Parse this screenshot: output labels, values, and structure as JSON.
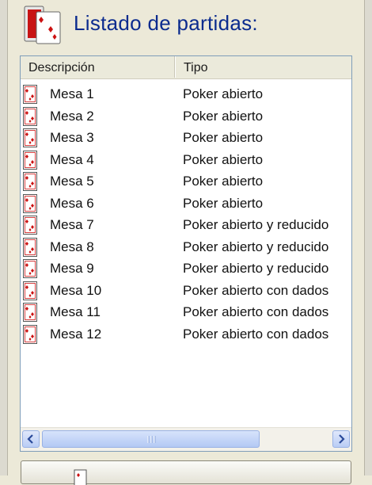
{
  "header": {
    "title": "Listado de partidas:",
    "icon": "playing-cards-icon"
  },
  "list": {
    "columns": [
      "Descripción",
      "Tipo"
    ],
    "rows": [
      {
        "desc": "Mesa 1",
        "type": "Poker abierto"
      },
      {
        "desc": "Mesa 2",
        "type": "Poker abierto"
      },
      {
        "desc": "Mesa 3",
        "type": "Poker abierto"
      },
      {
        "desc": "Mesa 4",
        "type": "Poker abierto"
      },
      {
        "desc": "Mesa 5",
        "type": "Poker abierto"
      },
      {
        "desc": "Mesa 6",
        "type": "Poker abierto"
      },
      {
        "desc": "Mesa 7",
        "type": "Poker abierto y reducido"
      },
      {
        "desc": "Mesa 8",
        "type": "Poker abierto y reducido"
      },
      {
        "desc": "Mesa 9",
        "type": "Poker abierto y reducido"
      },
      {
        "desc": "Mesa 10",
        "type": "Poker abierto con dados"
      },
      {
        "desc": "Mesa 11",
        "type": "Poker abierto con dados"
      },
      {
        "desc": "Mesa 12",
        "type": "Poker abierto con dados"
      }
    ],
    "row_icon": "playing-card-icon"
  },
  "scrollbar": {
    "left_icon": "chevron-left-icon",
    "right_icon": "chevron-right-icon"
  },
  "colors": {
    "title": "#0b2b8e",
    "card_red": "#cc1111",
    "scroll_blue": "#b9cdf5"
  }
}
